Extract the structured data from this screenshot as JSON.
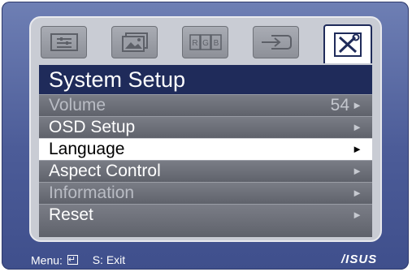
{
  "osd": {
    "tabs": [
      {
        "icon": "splendid-settings-icon",
        "active": false
      },
      {
        "icon": "picture-icon",
        "active": false
      },
      {
        "icon": "rgb-color-icon",
        "label": "RGB",
        "active": false
      },
      {
        "icon": "input-select-icon",
        "active": false
      },
      {
        "icon": "tools-icon",
        "active": true
      }
    ],
    "title": "System Setup",
    "items": [
      {
        "label": "Volume",
        "value": "54",
        "arrow": "►",
        "dimmed": true
      },
      {
        "label": "OSD Setup",
        "arrow": "►",
        "dimmed": false
      },
      {
        "label": "Language",
        "arrow": "►",
        "selected": true
      },
      {
        "label": "Aspect Control",
        "arrow": "►",
        "dimmed": false
      },
      {
        "label": "Information",
        "arrow": "►",
        "dimmed": true
      },
      {
        "label": "Reset",
        "arrow": "►",
        "dimmed": false
      }
    ]
  },
  "footer": {
    "menu_label": "Menu:",
    "exit_label": "S: Exit",
    "brand": "/ISUS"
  },
  "colors": {
    "bezel": "#4c5c98",
    "title_bar": "#1f2b5a",
    "item_bg": "#6b6e77",
    "selected_bg": "#ffffff"
  }
}
